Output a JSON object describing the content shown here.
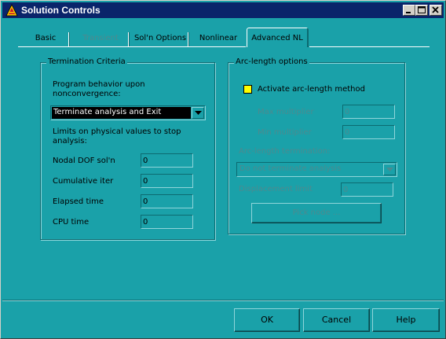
{
  "window": {
    "title": "Solution Controls"
  },
  "tabs": [
    {
      "label": "Basic",
      "enabled": true,
      "active": false
    },
    {
      "label": "Transient",
      "enabled": false,
      "active": false
    },
    {
      "label": "Sol'n Options",
      "enabled": true,
      "active": false
    },
    {
      "label": "Nonlinear",
      "enabled": true,
      "active": false
    },
    {
      "label": "Advanced NL",
      "enabled": true,
      "active": true
    }
  ],
  "termination": {
    "group_title": "Termination Criteria",
    "behavior_label": "Program behavior upon nonconvergence:",
    "behavior_value": "Terminate analysis and Exit",
    "limits_label": "Limits on physical values to stop analysis:",
    "nodal_dof_label": "Nodal DOF sol'n",
    "nodal_dof_value": "0",
    "cum_iter_label": "Cumulative iter",
    "cum_iter_value": "0",
    "elapsed_label": "Elapsed time",
    "elapsed_value": "0",
    "cpu_label": "CPU time",
    "cpu_value": "0"
  },
  "arclength": {
    "group_title": "Arc-length options",
    "activate_label": "Activate arc-length method",
    "activate_checked": false,
    "max_mult_label": "Max multiplier",
    "max_mult_value": "0",
    "min_mult_label": "Min multiplier",
    "min_mult_value": "0",
    "termination_label": "Arc-length termination:",
    "termination_value": "Do not terminate analysis",
    "disp_limit_label": "Displacement limit",
    "disp_limit_value": "0",
    "pick_node_label": "Pick node ..."
  },
  "buttons": {
    "ok": "OK",
    "cancel": "Cancel",
    "help": "Help"
  },
  "colors": {
    "background": "#1aa1a9",
    "titlebar": "#0a246a",
    "checkbox": "#ffff00"
  }
}
